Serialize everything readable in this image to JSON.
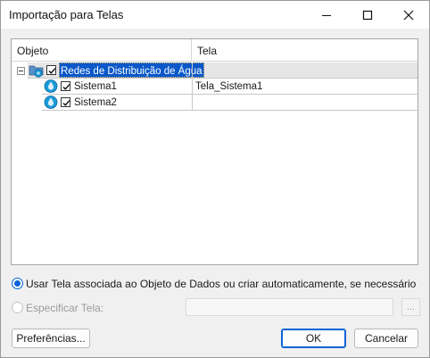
{
  "window": {
    "title": "Importação para Telas"
  },
  "grid": {
    "columns": [
      "Objeto",
      "Tela"
    ],
    "rows": [
      {
        "label": "Redes de Distribuição de Água",
        "screen": "",
        "checked": true,
        "selected": true,
        "icon": "water-network-folder-icon"
      },
      {
        "label": "Sistema1",
        "screen": "Tela_Sistema1",
        "checked": true,
        "selected": false,
        "icon": "water-drop-icon"
      },
      {
        "label": "Sistema2",
        "screen": "",
        "checked": true,
        "selected": false,
        "icon": "water-drop-icon"
      }
    ]
  },
  "options": {
    "use_associated": "Usar Tela associada ao Objeto de Dados ou criar automaticamente, se necessário",
    "specify_screen": "Especificar Tela:",
    "screen_value": "",
    "browse": "..."
  },
  "buttons": {
    "preferences": "Preferências...",
    "ok": "OK",
    "cancel": "Cancelar"
  },
  "colors": {
    "accent": "#0a63d6",
    "selection": "#0a58c9",
    "drop": "#1b9bd8"
  }
}
